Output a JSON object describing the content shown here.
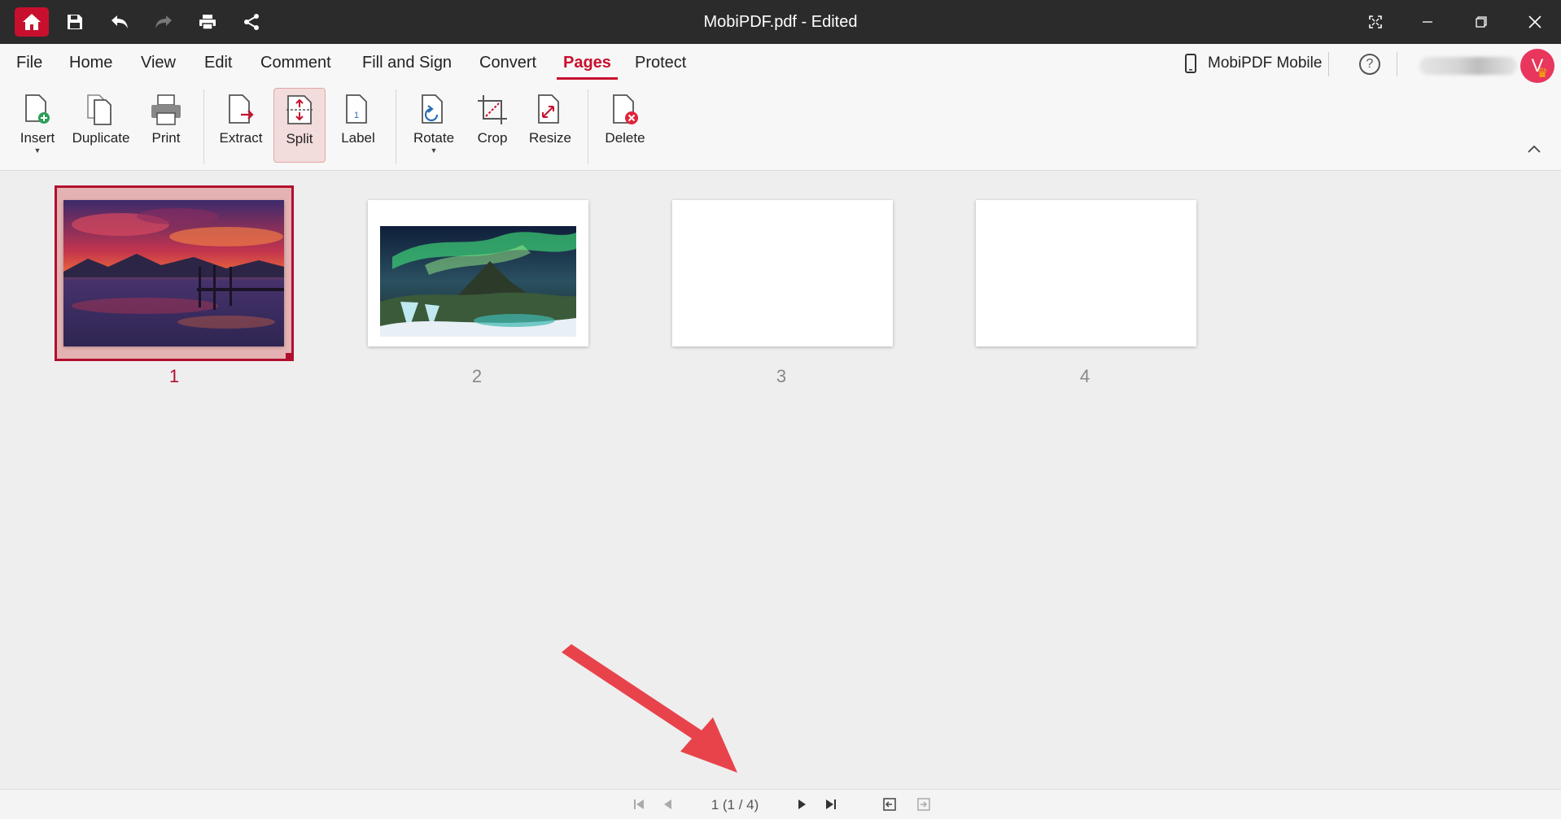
{
  "window": {
    "title": "MobiPDF.pdf - Edited"
  },
  "menu": {
    "items": [
      "File",
      "Home",
      "View",
      "Edit",
      "Comment",
      "Fill and Sign",
      "Convert",
      "Pages",
      "Protect"
    ],
    "active": "Pages",
    "mobile_label": "MobiPDF Mobile",
    "help_label": "?",
    "avatar_initial": "V"
  },
  "ribbon": {
    "insert": "Insert",
    "duplicate": "Duplicate",
    "print": "Print",
    "extract": "Extract",
    "split": "Split",
    "label": "Label",
    "label_icon_text": "1",
    "rotate": "Rotate",
    "crop": "Crop",
    "resize": "Resize",
    "delete": "Delete",
    "active": "Split"
  },
  "pages": [
    {
      "number": "1",
      "content": "sunset-lake-photo",
      "selected": true
    },
    {
      "number": "2",
      "content": "aurora-waterfall-photo",
      "selected": false
    },
    {
      "number": "3",
      "content": "blank",
      "selected": false
    },
    {
      "number": "4",
      "content": "blank",
      "selected": false
    }
  ],
  "statusbar": {
    "page_indicator": "1 (1 / 4)"
  },
  "colors": {
    "accent": "#c8102e",
    "titlebar": "#2b2b2b",
    "annotation_arrow": "#e8434b"
  }
}
